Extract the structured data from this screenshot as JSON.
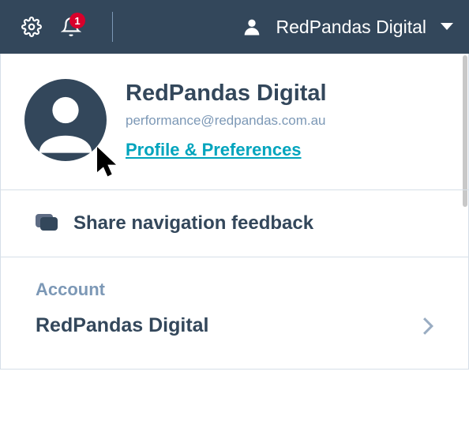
{
  "topbar": {
    "notification_count": "1",
    "account_name": "RedPandas Digital"
  },
  "profile": {
    "name": "RedPandas Digital",
    "email": "performance@redpandas.com.au",
    "preferences_link": "Profile & Preferences"
  },
  "feedback": {
    "label": "Share navigation feedback"
  },
  "account": {
    "heading": "Account",
    "name": "RedPandas Digital"
  }
}
